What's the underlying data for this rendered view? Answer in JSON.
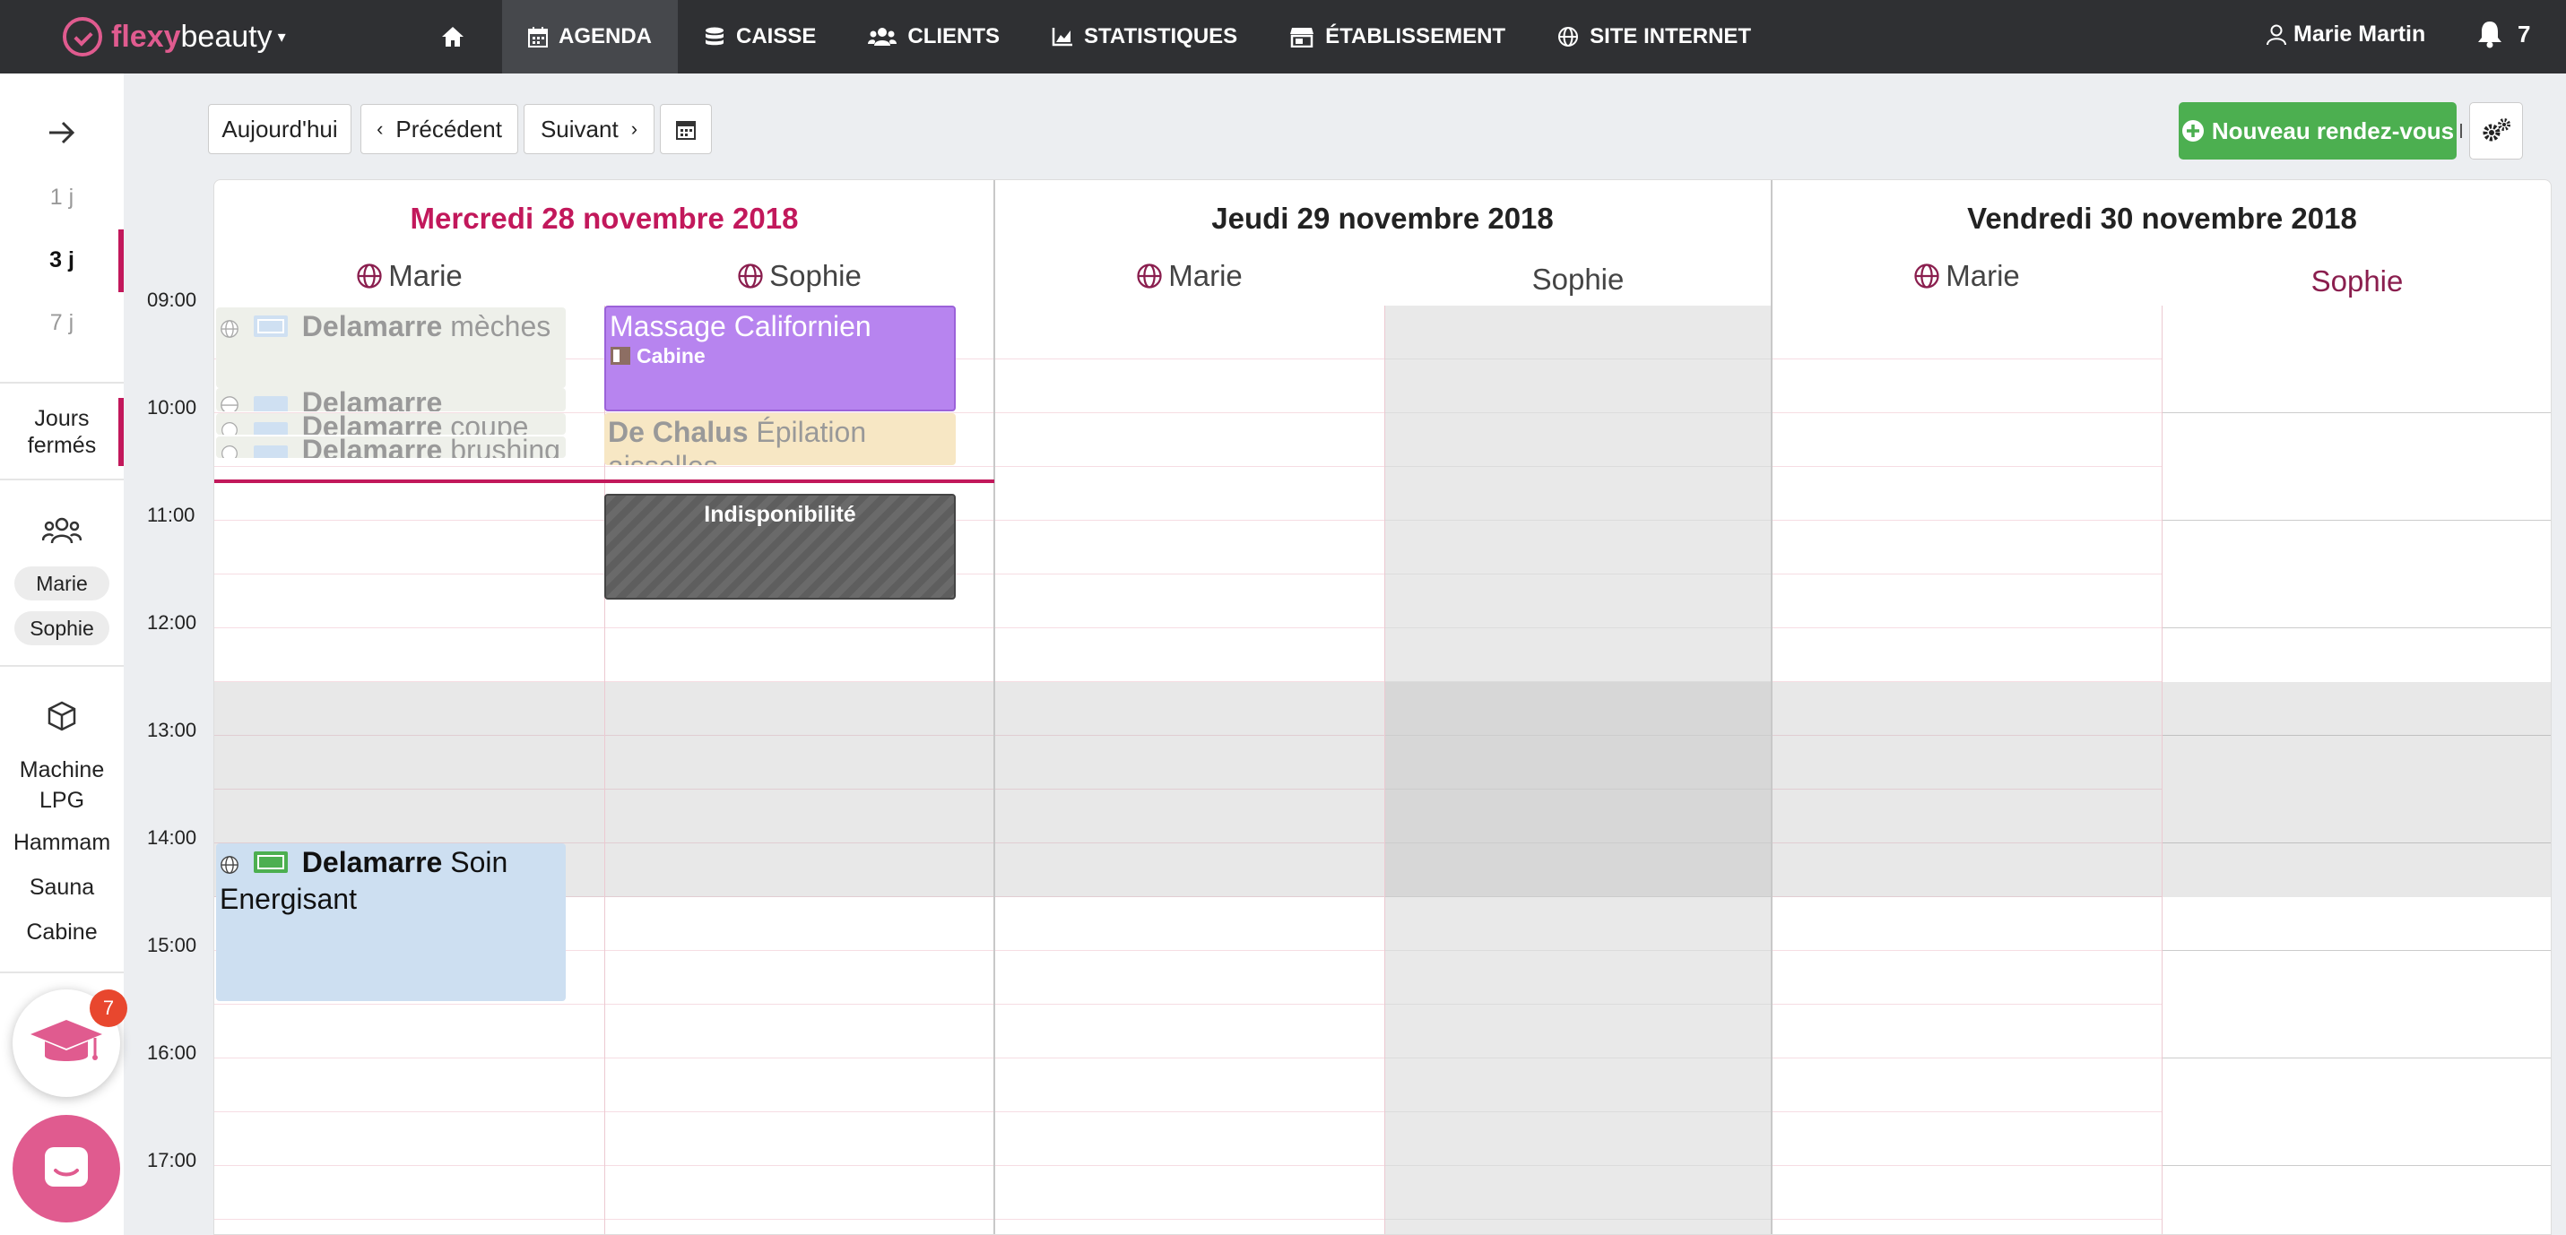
{
  "app": {
    "logo_part1": "flexy",
    "logo_part2": "beauty"
  },
  "nav": {
    "items": [
      {
        "label": "",
        "icon": "home-icon"
      },
      {
        "label": "AGENDA",
        "icon": "calendar-icon"
      },
      {
        "label": "CAISSE",
        "icon": "coins-icon"
      },
      {
        "label": "CLIENTS",
        "icon": "users-icon"
      },
      {
        "label": "STATISTIQUES",
        "icon": "chart-icon"
      },
      {
        "label": "ÉTABLISSEMENT",
        "icon": "store-icon"
      },
      {
        "label": "SITE INTERNET",
        "icon": "globe-icon"
      }
    ],
    "user_name": "Marie Martin",
    "notifications_count": "7"
  },
  "sidebar": {
    "views": [
      "1 j",
      "3 j",
      "7 j"
    ],
    "closed_days": "Jours fermés",
    "staff": [
      "Marie",
      "Sophie"
    ],
    "resources": [
      "Machine LPG",
      "Hammam",
      "Sauna",
      "Cabine"
    ],
    "learn_badge": "7"
  },
  "toolbar": {
    "today": "Aujourd'hui",
    "previous": "Précédent",
    "next": "Suivant",
    "new_appointment": "Nouveau rendez-vous"
  },
  "calendar": {
    "times": [
      "09:00",
      "10:00",
      "11:00",
      "12:00",
      "13:00",
      "14:00",
      "15:00",
      "16:00",
      "17:00"
    ],
    "days": [
      {
        "title": "Mercredi 28 novembre 2018",
        "resources": [
          "Marie",
          "Sophie"
        ]
      },
      {
        "title": "Jeudi 29 novembre 2018",
        "resources": [
          "Marie",
          "Sophie"
        ]
      },
      {
        "title": "Vendredi 30 novembre 2018",
        "resources": [
          "Marie",
          "Sophie"
        ]
      }
    ],
    "events": {
      "e1": {
        "client": "Delamarre",
        "service": "mèches"
      },
      "e2": {
        "client": "Delamarre",
        "service": ""
      },
      "e3": {
        "client": "Delamarre",
        "service": "coupe"
      },
      "e4": {
        "client": "Delamarre",
        "service": "brushing"
      },
      "e5": {
        "title": "Massage Californien",
        "room": "Cabine"
      },
      "e6": {
        "client": "De Chalus",
        "service": "Épilation aisselles"
      },
      "e7": {
        "title": "Indisponibilité"
      },
      "e8": {
        "client": "Delamarre",
        "service": "Soin Energisant"
      }
    }
  },
  "colors": {
    "brand": "#e05b8f",
    "accent": "#c2185b",
    "success": "#4caf50"
  }
}
